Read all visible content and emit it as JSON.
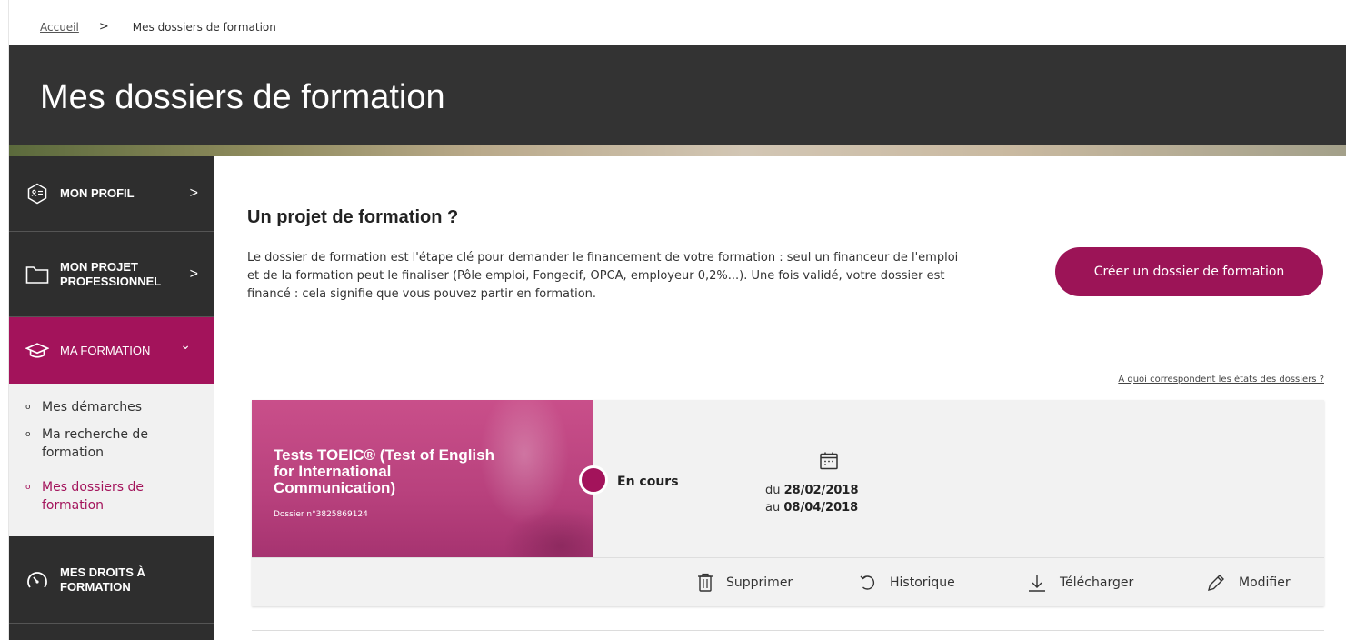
{
  "breadcrumb": {
    "home": "Accueil",
    "separator": ">",
    "current": "Mes dossiers de formation"
  },
  "header": {
    "title": "Mes dossiers de formation"
  },
  "sidebar": {
    "items": [
      {
        "label": "MON PROFIL",
        "icon": "id-card-icon",
        "chevron": ">"
      },
      {
        "label_line1": "MON PROJET",
        "label_line2": "PROFESSIONNEL",
        "icon": "folder-icon",
        "chevron": ">"
      },
      {
        "label": "MA FORMATION",
        "icon": "graduation-cap-icon",
        "chevron": "⌄"
      },
      {
        "label_line1": "MES DROITS À",
        "label_line2": "FORMATION",
        "icon": "gauge-icon"
      }
    ],
    "submenu": [
      {
        "label_line1": "Mes démarches",
        "label_line2": ""
      },
      {
        "label_line1": "Ma recherche de",
        "label_line2": "formation"
      },
      {
        "label_line1": "Mes dossiers de",
        "label_line2": "formation"
      }
    ],
    "bullet": "o"
  },
  "main": {
    "title": "Un projet de formation ?",
    "intro": "Le dossier de formation est l'étape clé pour demander le financement de votre formation : seul un financeur de l'emploi et de la formation peut le finaliser (Pôle emploi, Fongecif, OPCA, employeur 0,2%...). Une fois validé, votre dossier est financé : cela signifie que vous pouvez partir en formation.",
    "create_button": "Créer un dossier de formation",
    "states_link": "A quoi correspondent les états des dossiers ?"
  },
  "card": {
    "title": "Tests TOEIC® (Test of English for International Communication)",
    "dossier": "Dossier n°3825869124",
    "status": "En cours",
    "date_from_prefix": "du",
    "date_from": "28/02/2018",
    "date_to_prefix": "au",
    "date_to": "08/04/2018",
    "actions": [
      {
        "label": "Supprimer",
        "icon": "trash-icon"
      },
      {
        "label": "Historique",
        "icon": "history-icon"
      },
      {
        "label": "Télécharger",
        "icon": "download-icon"
      },
      {
        "label": "Modifier",
        "icon": "pencil-icon"
      }
    ]
  },
  "colors": {
    "accent": "#a3135b",
    "header_bg": "#333333",
    "sidebar_bg": "#2e2e2e",
    "card_bg": "#f2f2f2"
  }
}
